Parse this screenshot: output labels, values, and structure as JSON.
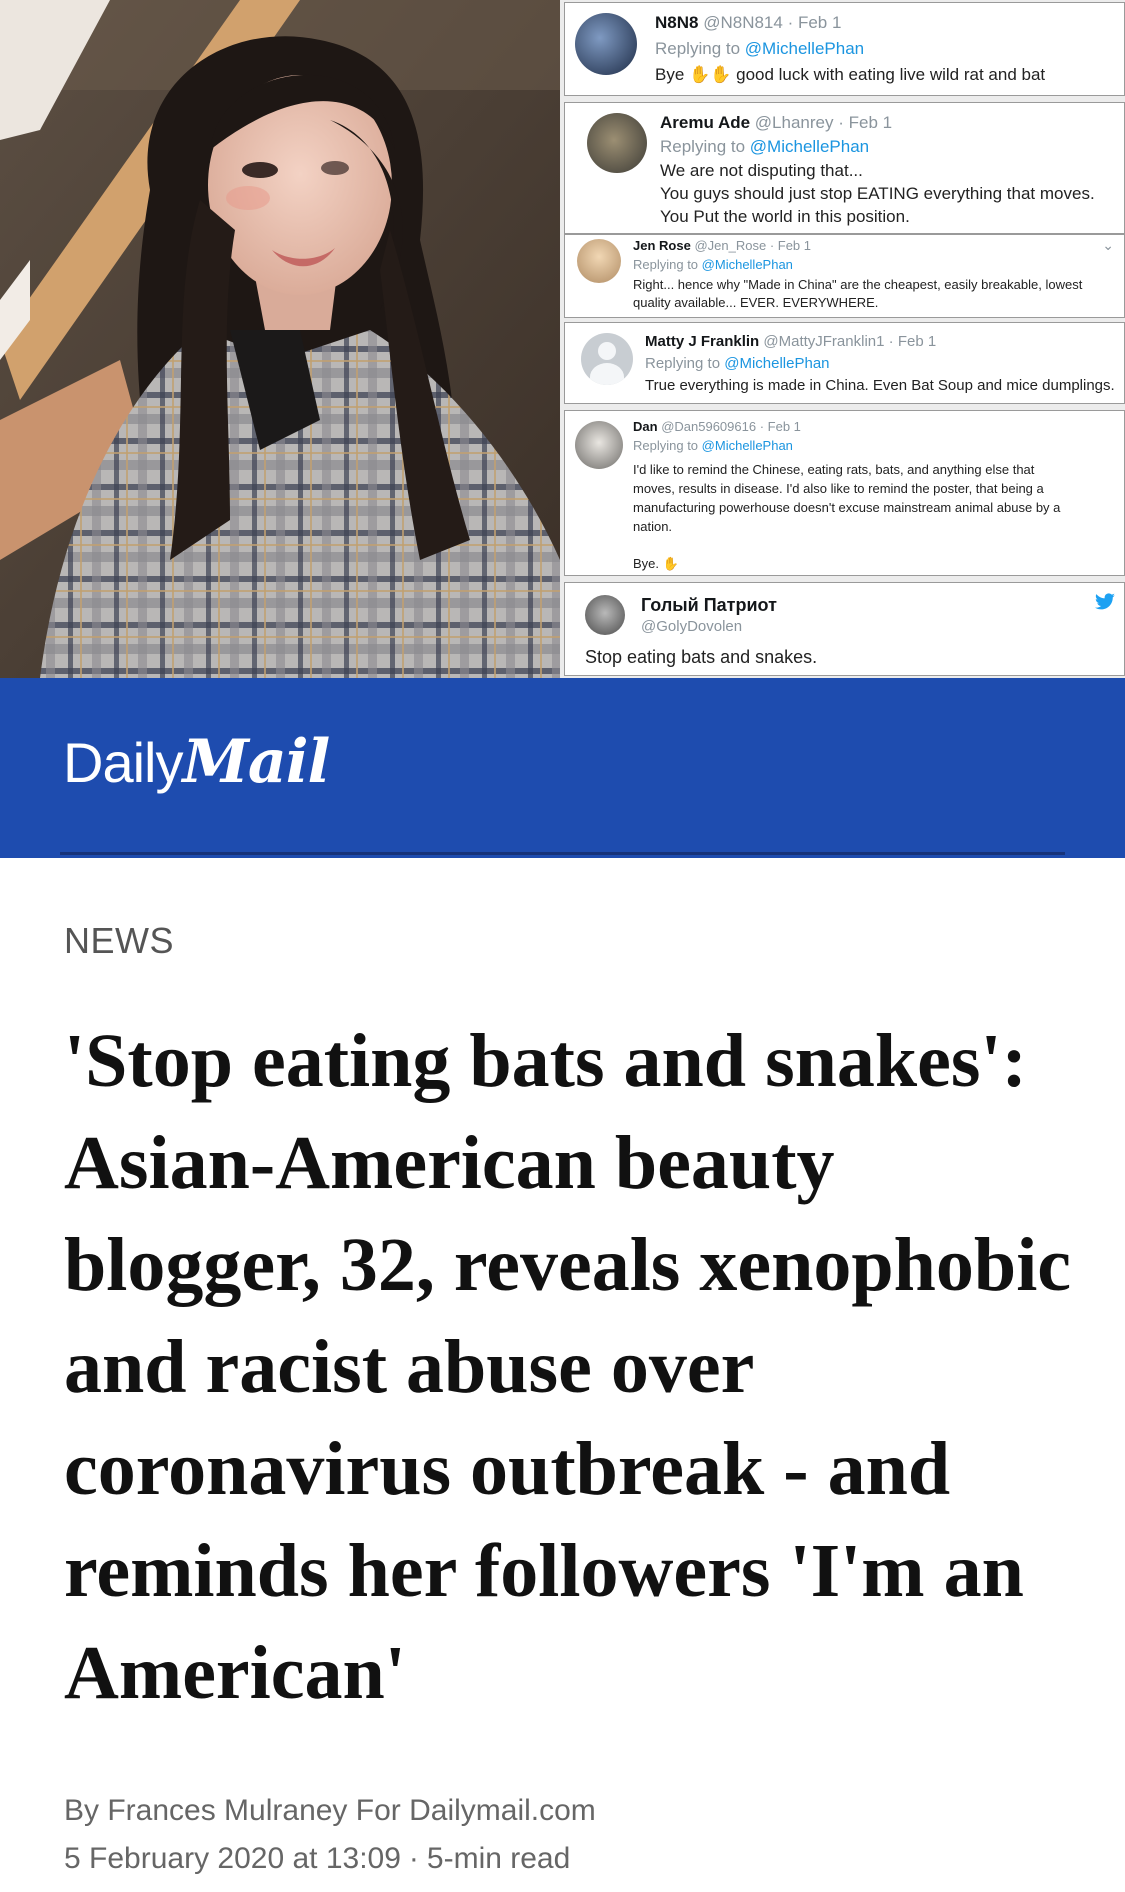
{
  "tweets": [
    {
      "name": "N8N8",
      "handle": "@N8N814",
      "date": "Feb 1",
      "replying_prefix": "Replying to",
      "replying_to": "@MichellePhan",
      "lines": [
        "Bye",
        "good luck with eating live wild rat and bat"
      ]
    },
    {
      "name": "Aremu Ade",
      "handle": "@Lhanrey",
      "date": "Feb 1",
      "replying_prefix": "Replying to",
      "replying_to": "@MichellePhan",
      "lines": [
        "We are not disputing that...",
        "You guys should just stop EATING everything that moves.",
        "You Put the world in this position."
      ]
    },
    {
      "name": "Jen Rose",
      "handle": "@Jen_Rose",
      "date": "Feb 1",
      "replying_prefix": "Replying to",
      "replying_to": "@MichellePhan",
      "lines": [
        "Right... hence why \"Made in China\" are the cheapest, easily breakable, lowest",
        "quality available... EVER. EVERYWHERE."
      ]
    },
    {
      "name": "Matty J Franklin",
      "handle": "@MattyJFranklin1",
      "date": "Feb 1",
      "replying_prefix": "Replying to",
      "replying_to": "@MichellePhan",
      "lines": [
        "True everything is made in China. Even Bat Soup and mice dumplings."
      ]
    },
    {
      "name": "Dan",
      "handle": "@Dan59609616",
      "date": "Feb 1",
      "replying_prefix": "Replying to",
      "replying_to": "@MichellePhan",
      "lines": [
        "I'd like to remind the Chinese, eating rats, bats, and anything else that",
        "moves, results in disease. I'd also like to remind the poster, that being a",
        "manufacturing powerhouse doesn't excuse mainstream animal abuse by a",
        "nation.",
        "Bye."
      ]
    },
    {
      "name": "Голый Патриот",
      "handle": "@GolyDovolen",
      "lines": [
        "Stop eating bats and snakes."
      ]
    }
  ],
  "brand": {
    "logo_part1": "Daily",
    "logo_part2": "Mail",
    "bar_color": "#1e4caf"
  },
  "article": {
    "section": "NEWS",
    "headline": "'Stop eating bats and snakes': Asian-American beauty blogger, 32, reveals xenophobic and racist abuse over coronavirus outbreak - and reminds her followers 'I'm an American'",
    "byline": "By Frances Mulraney For Dailymail.com",
    "date": "5 February 2020 at 13:09",
    "separator": "·",
    "read_time": "5-min read"
  }
}
